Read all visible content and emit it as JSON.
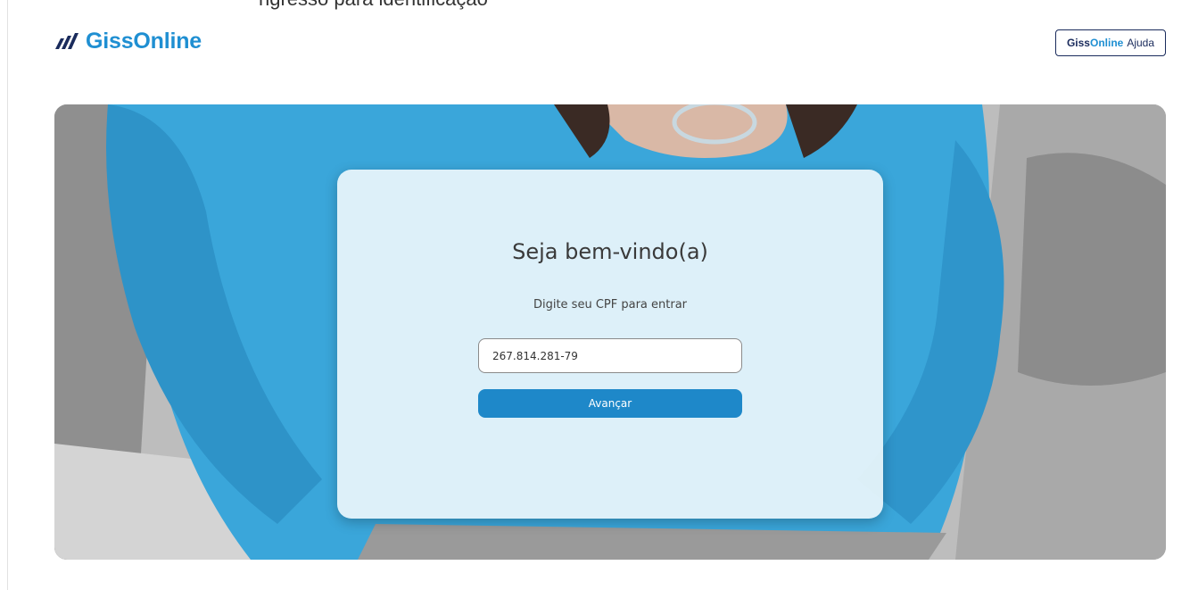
{
  "header": {
    "top_cut_text": "ngresso para identificação",
    "logo_text": "GissOnline",
    "help_button": {
      "brand_part1": "Giss",
      "brand_part2": "Online",
      "label": "Ajuda"
    }
  },
  "login": {
    "title": "Seja bem-vindo(a)",
    "subtitle": "Digite seu CPF para entrar",
    "cpf_value": "267.814.281-79",
    "cpf_placeholder": "",
    "submit_label": "Avançar"
  },
  "colors": {
    "brand_blue": "#1f8fd2",
    "button_blue": "#1e88c9",
    "navy": "#1a2b5c"
  },
  "icons": {
    "logo_mark": "bar-chart-slant-icon"
  }
}
